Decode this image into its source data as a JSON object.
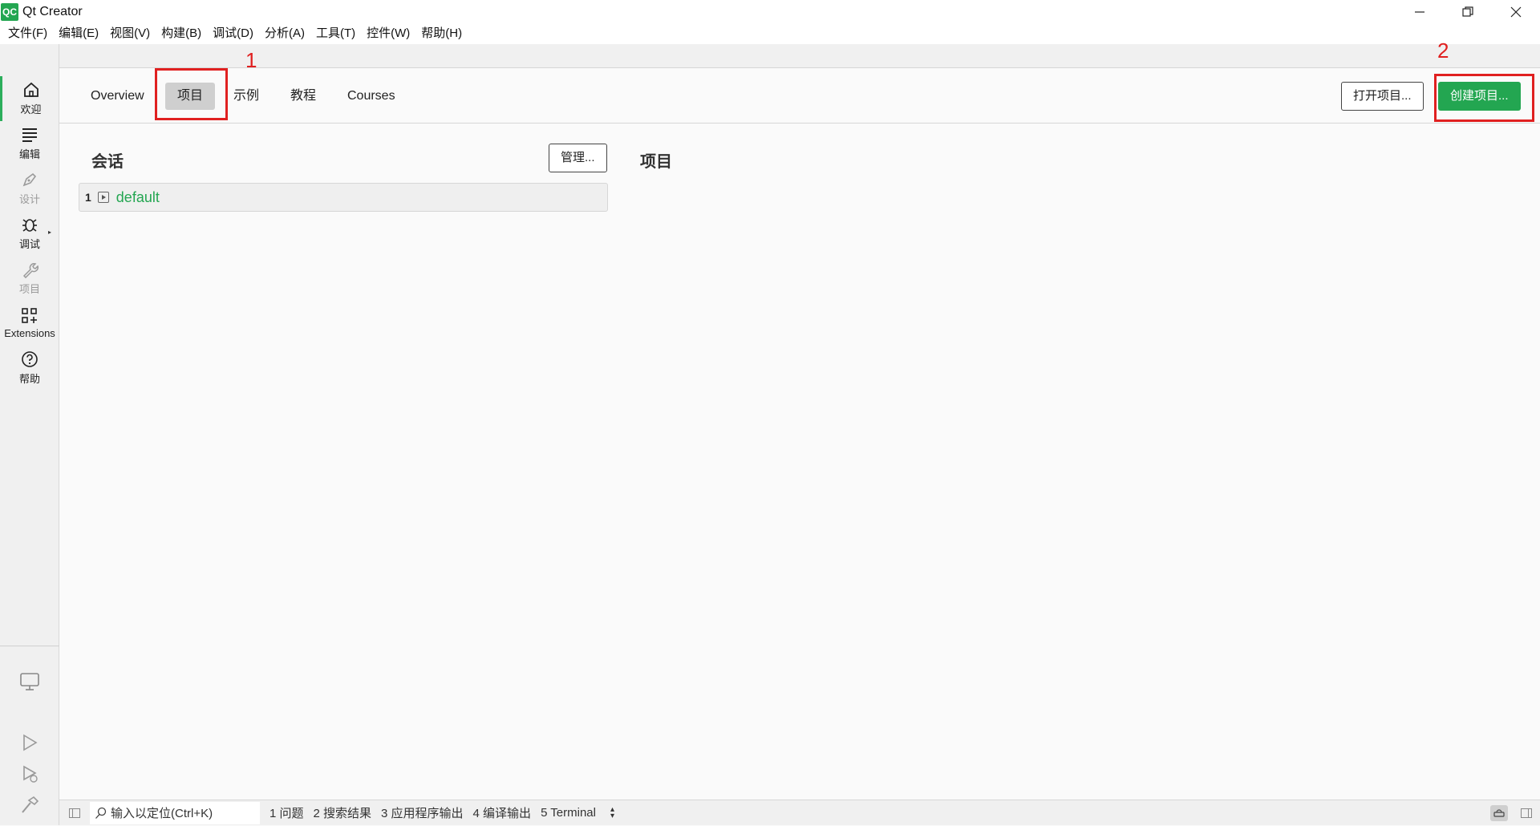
{
  "window": {
    "logo": "QC",
    "title": "Qt Creator"
  },
  "menu": [
    "文件(F)",
    "编辑(E)",
    "视图(V)",
    "构建(B)",
    "调试(D)",
    "分析(A)",
    "工具(T)",
    "控件(W)",
    "帮助(H)"
  ],
  "modes": [
    {
      "label": "欢迎",
      "icon": "home-icon",
      "active": true,
      "enabled": true
    },
    {
      "label": "编辑",
      "icon": "edit-lines-icon",
      "active": false,
      "enabled": true
    },
    {
      "label": "设计",
      "icon": "pen-icon",
      "active": false,
      "enabled": false
    },
    {
      "label": "调试",
      "icon": "bug-icon",
      "active": false,
      "enabled": true
    },
    {
      "label": "项目",
      "icon": "wrench-icon",
      "active": false,
      "enabled": false
    },
    {
      "label": "Extensions",
      "icon": "extensions-icon",
      "active": false,
      "enabled": true
    },
    {
      "label": "帮助",
      "icon": "help-icon",
      "active": false,
      "enabled": true
    }
  ],
  "welcome": {
    "tabs": [
      "Overview",
      "项目",
      "示例",
      "教程",
      "Courses"
    ],
    "active_tab": "项目",
    "open_project_label": "打开项目...",
    "create_project_label": "创建项目..."
  },
  "annotations": {
    "one": "1",
    "two": "2"
  },
  "sessions": {
    "title": "会话",
    "manage_label": "管理...",
    "items": [
      {
        "index": "1",
        "name": "default"
      }
    ]
  },
  "projects": {
    "title": "项目"
  },
  "statusbar": {
    "locator_placeholder": "输入以定位(Ctrl+K)",
    "panes": [
      "1 问题",
      "2 搜索结果",
      "3 应用程序输出",
      "4 编译输出",
      "5 Terminal"
    ]
  },
  "colors": {
    "accent": "#23a651",
    "annotation": "#e02020"
  }
}
